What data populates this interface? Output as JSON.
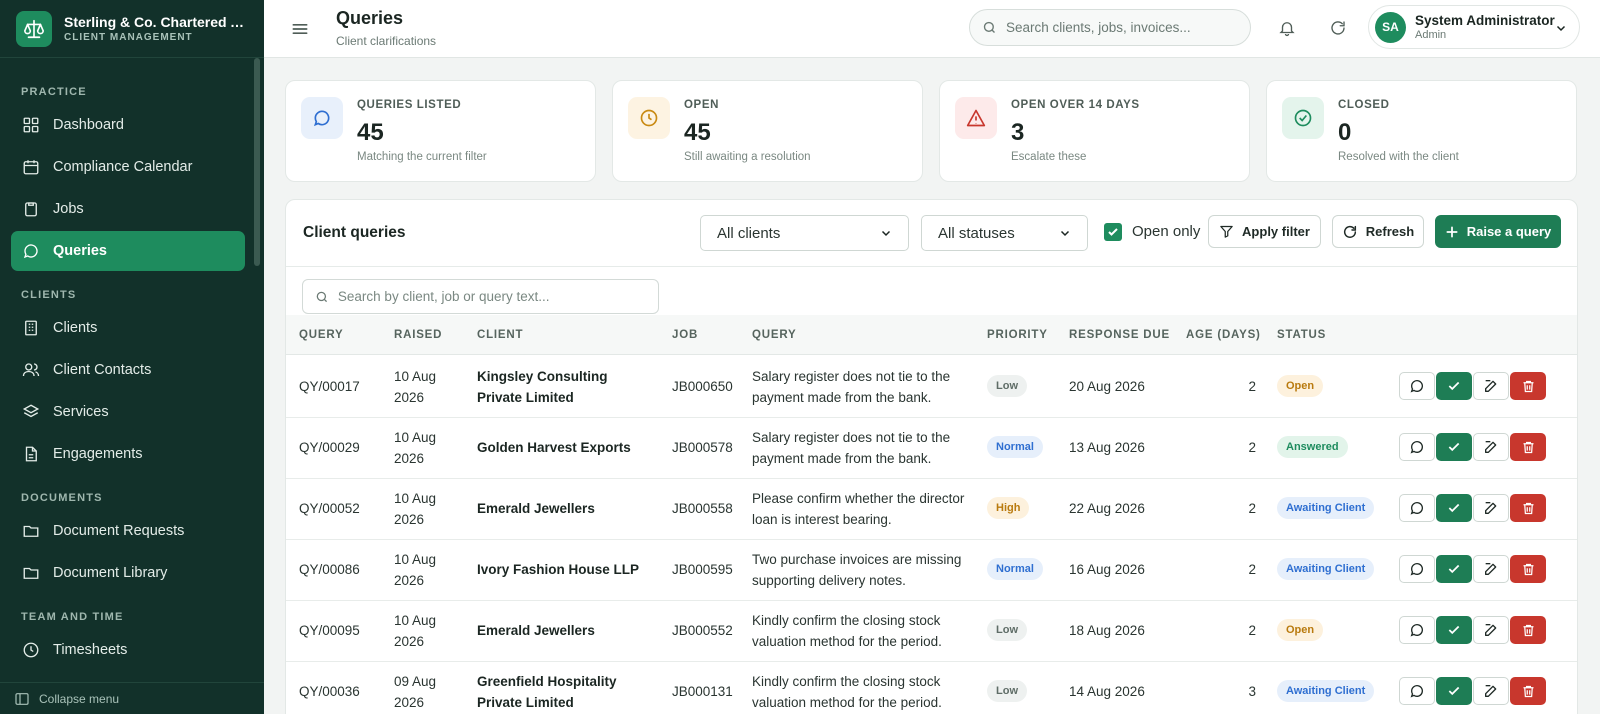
{
  "sidebar": {
    "brand_name": "Sterling & Co. Chartered Accountants",
    "brand_sub": "CLIENT MANAGEMENT",
    "sections": {
      "practice": "PRACTICE",
      "clients": "CLIENTS",
      "documents": "DOCUMENTS",
      "team": "TEAM AND TIME"
    },
    "items": [
      {
        "label": "Dashboard",
        "icon": "grid-icon"
      },
      {
        "label": "Compliance Calendar",
        "icon": "calendar-icon"
      },
      {
        "label": "Jobs",
        "icon": "clipboard-icon"
      },
      {
        "label": "Queries",
        "icon": "chat-icon",
        "active": true
      },
      {
        "label": "Clients",
        "icon": "building-icon"
      },
      {
        "label": "Client Contacts",
        "icon": "users-icon"
      },
      {
        "label": "Services",
        "icon": "layers-icon"
      },
      {
        "label": "Engagements",
        "icon": "document-icon"
      },
      {
        "label": "Document Requests",
        "icon": "folder-icon"
      },
      {
        "label": "Document Library",
        "icon": "folder-icon"
      },
      {
        "label": "Timesheets",
        "icon": "clock-icon"
      }
    ],
    "collapse_label": "Collapse menu"
  },
  "header": {
    "title": "Queries",
    "subtitle": "Client clarifications",
    "search_placeholder": "Search clients, jobs, invoices...",
    "user_initials": "SA",
    "user_name": "System Administrator",
    "user_role": "Admin"
  },
  "stats": [
    {
      "label": "QUERIES LISTED",
      "value": "45",
      "note": "Matching the current filter",
      "icon": "chat-icon",
      "bg": "#e8f0fb",
      "color": "#2f6fd1"
    },
    {
      "label": "OPEN",
      "value": "45",
      "note": "Still awaiting a resolution",
      "icon": "clock-icon",
      "bg": "#fdf3e2",
      "color": "#c98a13"
    },
    {
      "label": "OPEN OVER 14 DAYS",
      "value": "3",
      "note": "Escalate these",
      "icon": "warning-icon",
      "bg": "#fdeaea",
      "color": "#c8372d"
    },
    {
      "label": "CLOSED",
      "value": "0",
      "note": "Resolved with the client",
      "icon": "check-circle-icon",
      "bg": "#e4f4ec",
      "color": "#1e8c5e"
    }
  ],
  "panel": {
    "title": "Client queries",
    "client_filter": "All clients",
    "status_filter": "All statuses",
    "open_only_label": "Open only",
    "open_only_checked": true,
    "apply_label": "Apply filter",
    "refresh_label": "Refresh",
    "raise_label": "Raise a query",
    "table_search_placeholder": "Search by client, job or query text..."
  },
  "table": {
    "columns": [
      "QUERY",
      "RAISED",
      "CLIENT",
      "JOB",
      "QUERY",
      "PRIORITY",
      "RESPONSE DUE",
      "AGE (DAYS)",
      "STATUS"
    ],
    "rows": [
      {
        "id": "QY/00017",
        "raised": "10 Aug 2026",
        "client": "Kingsley Consulting Private Limited",
        "job": "JB000650",
        "query": "Salary register does not tie to the payment made from the bank.",
        "priority": "Low",
        "due": "20 Aug 2026",
        "age": "2",
        "status": "Open"
      },
      {
        "id": "QY/00029",
        "raised": "10 Aug 2026",
        "client": "Golden Harvest Exports",
        "job": "JB000578",
        "query": "Salary register does not tie to the payment made from the bank.",
        "priority": "Normal",
        "due": "13 Aug 2026",
        "age": "2",
        "status": "Answered"
      },
      {
        "id": "QY/00052",
        "raised": "10 Aug 2026",
        "client": "Emerald Jewellers",
        "job": "JB000558",
        "query": "Please confirm whether the director loan is interest bearing.",
        "priority": "High",
        "due": "22 Aug 2026",
        "age": "2",
        "status": "Awaiting Client"
      },
      {
        "id": "QY/00086",
        "raised": "10 Aug 2026",
        "client": "Ivory Fashion House LLP",
        "job": "JB000595",
        "query": "Two purchase invoices are missing supporting delivery notes.",
        "priority": "Normal",
        "due": "16 Aug 2026",
        "age": "2",
        "status": "Awaiting Client"
      },
      {
        "id": "QY/00095",
        "raised": "10 Aug 2026",
        "client": "Emerald Jewellers",
        "job": "JB000552",
        "query": "Kindly confirm the closing stock valuation method for the period.",
        "priority": "Low",
        "due": "18 Aug 2026",
        "age": "2",
        "status": "Open"
      },
      {
        "id": "QY/00036",
        "raised": "09 Aug 2026",
        "client": "Greenfield Hospitality Private Limited",
        "job": "JB000131",
        "query": "Kindly confirm the closing stock valuation method for the period.",
        "priority": "Low",
        "due": "14 Aug 2026",
        "age": "3",
        "status": "Awaiting Client"
      }
    ]
  },
  "colors": {
    "accent": "#1e8c5e",
    "sidebar_bg": "#12312a",
    "danger": "#c8372d"
  }
}
